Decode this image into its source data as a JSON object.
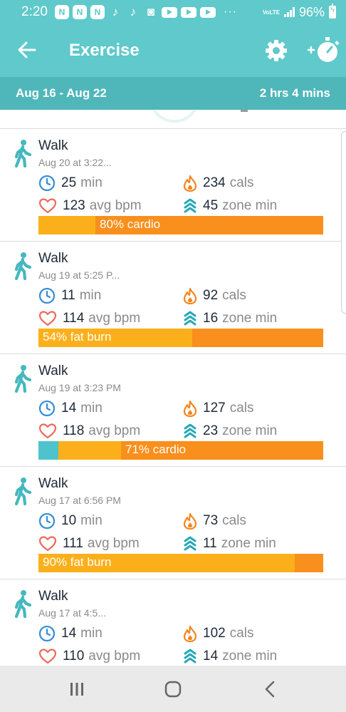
{
  "status_bar": {
    "time": "2:20",
    "app_icons": [
      "network-n-icon",
      "network-n-icon",
      "network-n-icon",
      "tiktok-icon",
      "tiktok-icon",
      "instagram-icon",
      "youtube-icon",
      "youtube-icon",
      "youtube-icon"
    ],
    "more": "···",
    "volte_top": "VoLTE",
    "volte_sub": "LTE",
    "battery": "96%"
  },
  "app_bar": {
    "title": "Exercise",
    "back_icon": "arrow-left-icon",
    "settings_icon": "gear-icon",
    "add_timer_icon": "plus-stopwatch-icon"
  },
  "summary": {
    "date_range": "Aug 16 - Aug 22",
    "total": "2 hrs 4 mins"
  },
  "colors": {
    "teal": "#5fc9cb",
    "teal_dark": "#4fb6ba",
    "fat_burn": "#fbb01b",
    "cardio": "#f98f1c",
    "peak": "#f36a1e",
    "out_of_zone": "#4fc3cb"
  },
  "exercises": [
    {
      "title": "Walk",
      "date": "Aug 20 at 3:22...",
      "duration": "25",
      "duration_unit": "min",
      "calories": "234",
      "calories_unit": "cals",
      "avg_bpm": "123",
      "avg_bpm_unit": "avg bpm",
      "zone_min": "45",
      "zone_min_unit": "zone min",
      "zone_label": "80% cardio",
      "zones": [
        {
          "zone": "fat_burn",
          "fraction": 0.2
        },
        {
          "zone": "cardio",
          "fraction": 0.8
        }
      ],
      "label_zone_index": 1
    },
    {
      "title": "Walk",
      "date": "Aug 19 at 5:25 P...",
      "duration": "11",
      "duration_unit": "min",
      "calories": "92",
      "calories_unit": "cals",
      "avg_bpm": "114",
      "avg_bpm_unit": "avg bpm",
      "zone_min": "16",
      "zone_min_unit": "zone min",
      "zone_label": "54% fat burn",
      "zones": [
        {
          "zone": "fat_burn",
          "fraction": 0.54
        },
        {
          "zone": "cardio",
          "fraction": 0.46
        }
      ],
      "label_zone_index": 0
    },
    {
      "title": "Walk",
      "date": "Aug 19 at 3:23 PM",
      "duration": "14",
      "duration_unit": "min",
      "calories": "127",
      "calories_unit": "cals",
      "avg_bpm": "118",
      "avg_bpm_unit": "avg bpm",
      "zone_min": "23",
      "zone_min_unit": "zone min",
      "zone_label": "71% cardio",
      "zones": [
        {
          "zone": "out_of_zone",
          "fraction": 0.07
        },
        {
          "zone": "fat_burn",
          "fraction": 0.22
        },
        {
          "zone": "cardio",
          "fraction": 0.71
        }
      ],
      "label_zone_index": 2
    },
    {
      "title": "Walk",
      "date": "Aug 17 at 6:56 PM",
      "duration": "10",
      "duration_unit": "min",
      "calories": "73",
      "calories_unit": "cals",
      "avg_bpm": "111",
      "avg_bpm_unit": "avg bpm",
      "zone_min": "11",
      "zone_min_unit": "zone min",
      "zone_label": "90% fat burn",
      "zones": [
        {
          "zone": "fat_burn",
          "fraction": 0.9
        },
        {
          "zone": "cardio",
          "fraction": 0.1
        }
      ],
      "label_zone_index": 0
    },
    {
      "title": "Walk",
      "date": "Aug 17 at 4:5...",
      "duration": "14",
      "duration_unit": "min",
      "calories": "102",
      "calories_unit": "cals",
      "avg_bpm": "110",
      "avg_bpm_unit": "avg bpm",
      "zone_min": "14",
      "zone_min_unit": "zone min",
      "zone_label": "",
      "zones": [],
      "label_zone_index": 0
    }
  ],
  "nav_bar": {
    "recents_icon": "recent-apps-icon",
    "home_icon": "home-icon",
    "back_icon": "back-chevron-icon"
  }
}
